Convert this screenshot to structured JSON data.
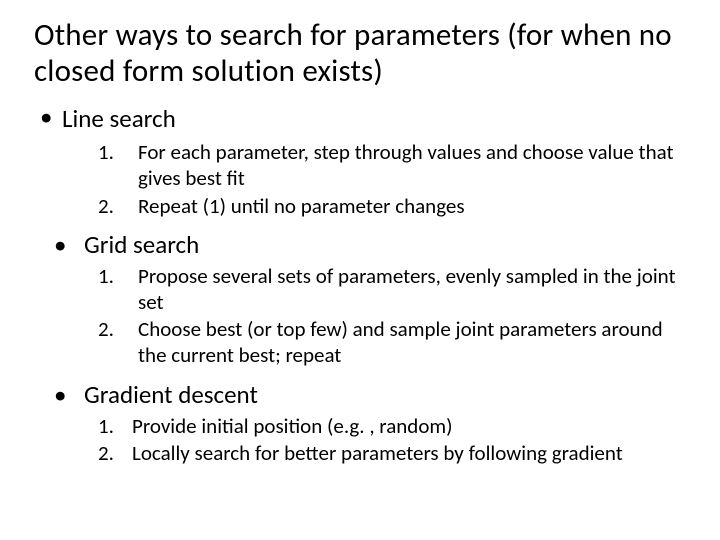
{
  "title": "Other ways to search for parameters (for when no closed form solution exists)",
  "sections": [
    {
      "heading": "Line search",
      "items": [
        "For each parameter, step through values and choose value that gives best fit",
        "Repeat (1) until no parameter changes"
      ]
    },
    {
      "heading": "Grid search",
      "items": [
        "Propose several sets of parameters, evenly sampled in the joint set",
        "Choose best (or top few) and sample joint parameters around the current best; repeat"
      ]
    },
    {
      "heading": "Gradient descent",
      "items": [
        "Provide initial position (e.g. , random)",
        "Locally search for better parameters by following gradient"
      ]
    }
  ]
}
